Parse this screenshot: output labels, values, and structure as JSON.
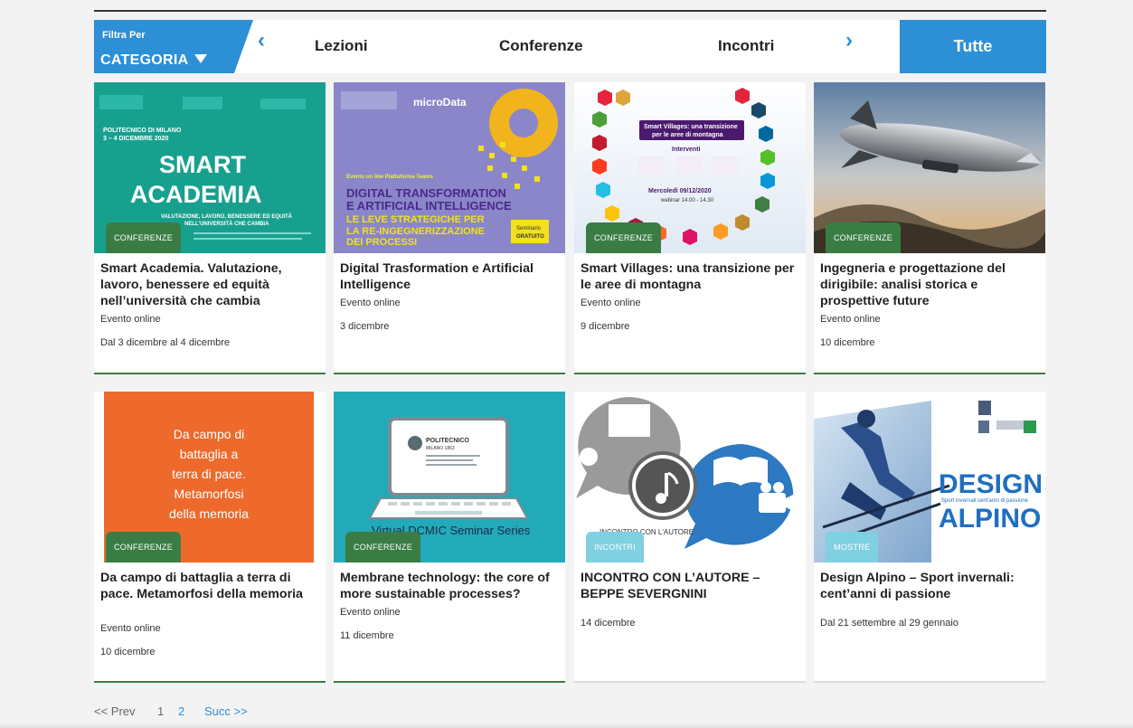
{
  "filter": {
    "label_small": "Filtra Per",
    "label_big": "CATEGORIA",
    "tabs": [
      "Lezioni",
      "Conferenze",
      "Incontri"
    ],
    "tab_all": "Tutte",
    "accent": "#2d8fd5"
  },
  "cards": [
    {
      "thumb": {
        "l1": "POLITECNICO DI MILANO",
        "l2": "3 – 4 DICEMBRE 2020",
        "big1": "SMART",
        "big2": "ACADEMIA",
        "sub1": "VALUTAZIONE, LAVORO, BENESSERE ED EQUITÀ",
        "sub2": "NELL'UNIVERSITÀ CHE CAMBIA"
      },
      "category": "CONFERENZE",
      "title": "Smart Academia. Valutazione, lavoro, benessere ed equità nell’università che cambia",
      "location": "Evento online",
      "date": "Dal 3 dicembre al 4 dicembre"
    },
    {
      "thumb": {
        "logo": "microData",
        "kicker": "Evento on line Piattaforma Teams",
        "h1": "DIGITAL TRANSFORMATION",
        "h2": "E ARTIFICIAL INTELLIGENCE",
        "s1": "LE LEVE STRATEGICHE PER",
        "s2": "LA RE-INGEGNERIZZAZIONE",
        "s3": "DEI PROCESSI",
        "sticker1": "Seminario",
        "sticker2": "GRATUITO"
      },
      "category": "",
      "title": "Digital Trasformation e Artificial Intelligence",
      "location": "Evento online",
      "date": "3 dicembre"
    },
    {
      "thumb": {
        "title1": "Smart Villages: una transizione",
        "title2": "per le aree di montagna",
        "interventi": "Interventi",
        "when": "Mercoledì 09/12/2020",
        "time": "webinar 14.00 - 14.30"
      },
      "category": "CONFERENZE",
      "title": "Smart Villages: una transizione per le aree di montagna",
      "location": "Evento online",
      "date": "9 dicembre"
    },
    {
      "thumb": {},
      "category": "CONFERENZE",
      "title": "Ingegneria e progettazione del dirigibile: analisi storica e prospettive future",
      "location": "Evento online",
      "date": "10 dicembre"
    },
    {
      "thumb": {
        "t1": "Da campo di",
        "t2": "battaglia a",
        "t3": "terra di pace.",
        "t4": "Metamorfosi",
        "t5": "della memoria"
      },
      "category": "CONFERENZE",
      "title": "Da campo di battaglia a terra di pace. Metamorfosi della memoria",
      "location": "Evento online",
      "date": "10 dicembre"
    },
    {
      "thumb": {
        "screen1": "POLITECNICO",
        "screen2": "MILANO 1863",
        "caption": "Virtual DCMIC Seminar Series"
      },
      "category": "CONFERENZE",
      "title": "Membrane technology: the core of more sustainable processes?",
      "location": "Evento online",
      "date": "11 dicembre"
    },
    {
      "thumb": {
        "caption": "INCONTRO CON L'AUTORE"
      },
      "category": "INCONTRI",
      "title": "INCONTRO CON L’AUTORE – BEPPE SEVERGNINI",
      "location": "",
      "date": "14 dicembre"
    },
    {
      "thumb": {
        "d1": "DESIGN",
        "d2": "ALPINO",
        "sub": "Sport invernali cent'anni di passione"
      },
      "category": "MOSTRE",
      "title": "Design Alpino – Sport invernali: cent’anni di passione",
      "location": "",
      "date": "Dal 21 settembre al 29 gennaio"
    }
  ],
  "pagination": {
    "prev": "<< Prev",
    "p1": "1",
    "p2": "2",
    "next": "Succ >>"
  }
}
